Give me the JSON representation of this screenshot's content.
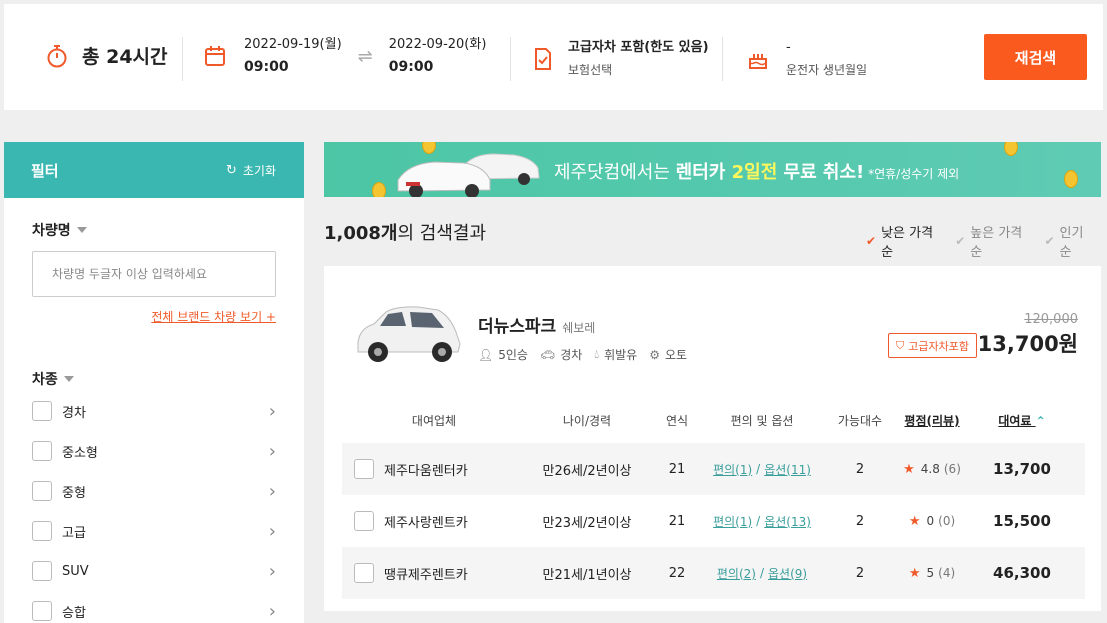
{
  "top": {
    "total": "총 24시간",
    "start_date": "2022-09-19(월)",
    "start_time": "09:00",
    "end_date": "2022-09-20(화)",
    "end_time": "09:00",
    "insurance_main": "고급자차 포함(한도 있음)",
    "insurance_sub": "보험선택",
    "driver_main": "-",
    "driver_sub": "운전자 생년월일",
    "search_button": "재검색"
  },
  "filter": {
    "title": "필터",
    "reset": "초기화",
    "car_name_title": "차량명",
    "car_name_placeholder": "차량명 두글자 이상 입력하세요",
    "brand_link": "전체 브랜드 차량 보기 +",
    "car_type_title": "차종",
    "types": [
      "경차",
      "중소형",
      "중형",
      "고급",
      "SUV",
      "승합"
    ]
  },
  "banner": {
    "part1": "제주닷컴에서는 ",
    "part2": "렌터카 ",
    "part3": "2일전",
    "part4": " 무료 취소!",
    "note": " *연휴/성수기 제외"
  },
  "results": {
    "count": "1,008개",
    "label": "의 검색결과",
    "sorts": [
      "낮은 가격순",
      "높은 가격순",
      "인기순"
    ]
  },
  "car": {
    "name": "더뉴스파크",
    "brand": "쉐보레",
    "specs": [
      "5인승",
      "경차",
      "휘발유",
      "오토"
    ],
    "old_price": "120,000",
    "badge": "고급자차포함",
    "price": "13,700원"
  },
  "table": {
    "headers": [
      "대여업체",
      "나이/경력",
      "연식",
      "편의 및 옵션",
      "가능대수",
      "평점(리뷰)",
      "대여료"
    ],
    "rows": [
      {
        "company": "제주다움렌터카",
        "age": "만26세/2년이상",
        "year": "21",
        "conv": "편의(1)",
        "opt": "옵션(11)",
        "count": "2",
        "rating": "4.8",
        "reviews": "(6)",
        "fee": "13,700"
      },
      {
        "company": "제주사랑렌트카",
        "age": "만23세/2년이상",
        "year": "21",
        "conv": "편의(1)",
        "opt": "옵션(13)",
        "count": "2",
        "rating": "0",
        "reviews": "(0)",
        "fee": "15,500"
      },
      {
        "company": "땡큐제주렌트카",
        "age": "만21세/1년이상",
        "year": "22",
        "conv": "편의(2)",
        "opt": "옵션(9)",
        "count": "2",
        "rating": "5",
        "reviews": "(4)",
        "fee": "46,300"
      }
    ]
  },
  "colors": {
    "accent": "#fa5a1e",
    "teal": "#3ab7b0",
    "banner": "#4cc6a5"
  }
}
